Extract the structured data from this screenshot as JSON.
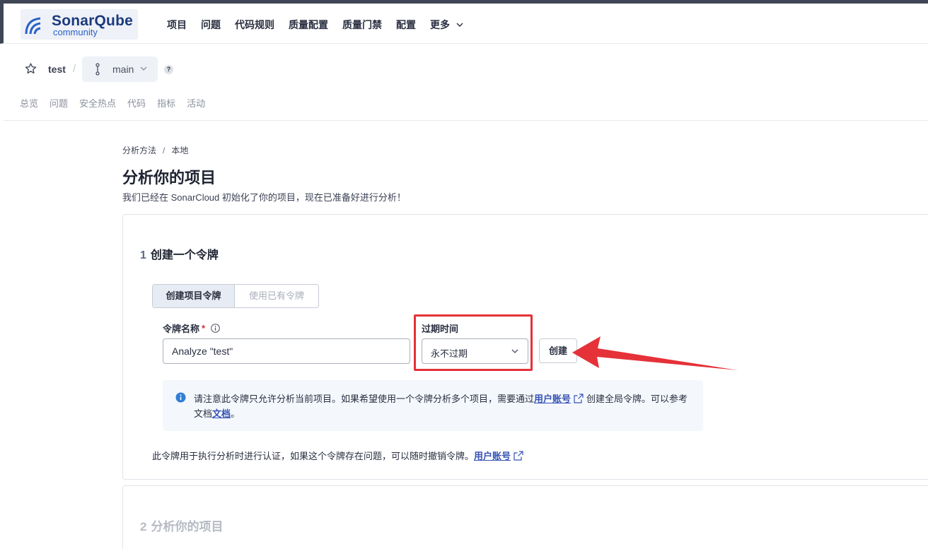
{
  "nav": {
    "brand": "SonarQube",
    "edition": "community",
    "items": [
      "项目",
      "问题",
      "代码规则",
      "质量配置",
      "质量门禁",
      "配置"
    ],
    "more": "更多"
  },
  "project": {
    "name": "test",
    "separator": "/",
    "branch": "main",
    "help": "?",
    "tabs": [
      "总览",
      "问题",
      "安全热点",
      "代码",
      "指标",
      "活动"
    ]
  },
  "page": {
    "breadcrumb": [
      "分析方法",
      "本地"
    ],
    "breadcrumb_sep": "/",
    "title": "分析你的项目",
    "subtitle": "我们已经在 SonarCloud 初始化了你的项目，现在已准备好进行分析！"
  },
  "step1": {
    "number": "1",
    "title": "创建一个令牌",
    "toggle": {
      "active": "创建项目令牌",
      "inactive": "使用已有令牌"
    },
    "token_label": "令牌名称",
    "required_mark": "*",
    "token_value": "Analyze \"test\"",
    "expiry_label": "过期时间",
    "expiry_value": "永不过期",
    "create_button": "创建",
    "note": {
      "text1": "请注意此令牌只允许分析当前项目。如果希望使用一个令牌分析多个项目，需要通过",
      "link1": "用户账号",
      "text2": "创建全局令牌。可以参考文档",
      "link2": "文档",
      "text3": "。"
    },
    "footnote": "此令牌用于执行分析时进行认证，如果这个令牌存在问题，可以随时撤销令牌。",
    "footnote_link": "用户账号"
  },
  "step2": {
    "number": "2",
    "title": "分析你的项目"
  },
  "colors": {
    "accent_link": "#3652b5",
    "highlight_red": "#e53238",
    "info_blue": "#2f7fd6"
  }
}
